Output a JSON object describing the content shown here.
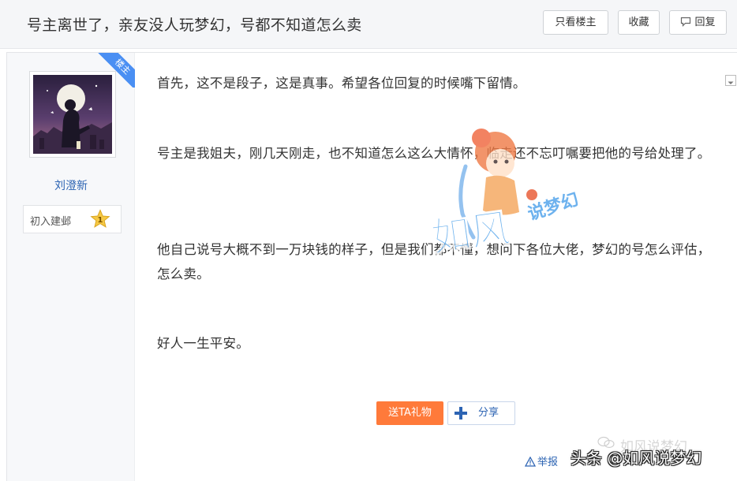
{
  "thread": {
    "title": "号主离世了，亲友没人玩梦幻，号都不知道怎么卖"
  },
  "toolbar": {
    "only_op_label": "只看楼主",
    "favorite_label": "收藏",
    "reply_label": "回复"
  },
  "author": {
    "badge": "楼主",
    "username": "刘澄新",
    "level_name": "初入建邺",
    "level_number": "1"
  },
  "post": {
    "paragraphs": [
      "首先，这不是段子，这是真事。希望各位回复的时候嘴下留情。",
      "号主是我姐夫，刚几天刚走，也不知道怎么这么大情怀，临走还不忘叮嘱要把他的号给处理了。",
      "他自己说号大概不到一万块钱的样子，但是我们都不懂，想问下各位大佬，梦幻的号怎么评估，怎么卖。",
      "好人一生平安。"
    ],
    "watermark_text_large": "如风",
    "watermark_text_small": "说梦幻"
  },
  "actions": {
    "gift_label": "送TA礼物",
    "share_label": "分享",
    "report_label": "举报"
  },
  "credits": {
    "faint_text": "如风说梦幻",
    "overlay_text": "头条 @如风说梦幻"
  },
  "colors": {
    "link_blue": "#2d64b3",
    "badge_blue": "#4a8ff3",
    "gift_orange": "#ff7a3a"
  }
}
